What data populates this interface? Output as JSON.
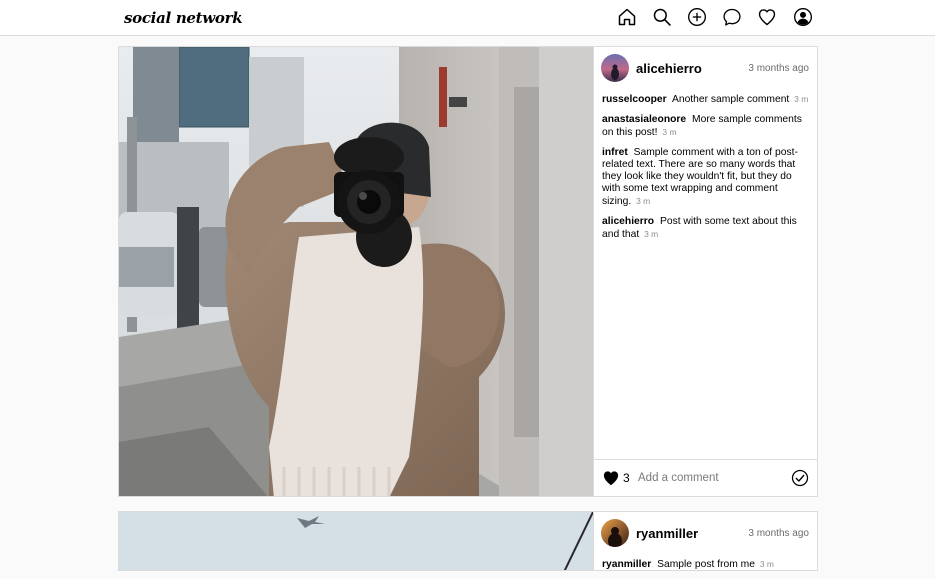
{
  "app": {
    "logo": "social network"
  },
  "nav": {
    "icons": [
      "home-icon",
      "search-icon",
      "add-post-icon",
      "messages-icon",
      "activity-heart-icon",
      "profile-icon"
    ]
  },
  "posts": [
    {
      "username": "alicehierro",
      "time_ago": "3 months ago",
      "comments": [
        {
          "user": "russelcooper",
          "text": "Another sample comment",
          "time": "3 m"
        },
        {
          "user": "anastasialeonore",
          "text": "More sample comments on this post!",
          "time": "3 m"
        },
        {
          "user": "infret",
          "text": "Sample comment with a ton of post-related text. There are so many words that they look like they wouldn't fit, but they do with some text wrapping and comment sizing.",
          "time": "3 m"
        },
        {
          "user": "alicehierro",
          "text": "Post with some text about this and that",
          "time": "3 m"
        }
      ],
      "likes": "3",
      "comment_placeholder": "Add a comment"
    },
    {
      "username": "ryanmiller",
      "time_ago": "3 months ago",
      "comments": [
        {
          "user": "ryanmiller",
          "text": "Sample post from me",
          "time": "3 m"
        }
      ]
    }
  ],
  "colors": {
    "border": "#dbdbdb",
    "muted": "#8e8e8e",
    "background": "#fafafa"
  }
}
